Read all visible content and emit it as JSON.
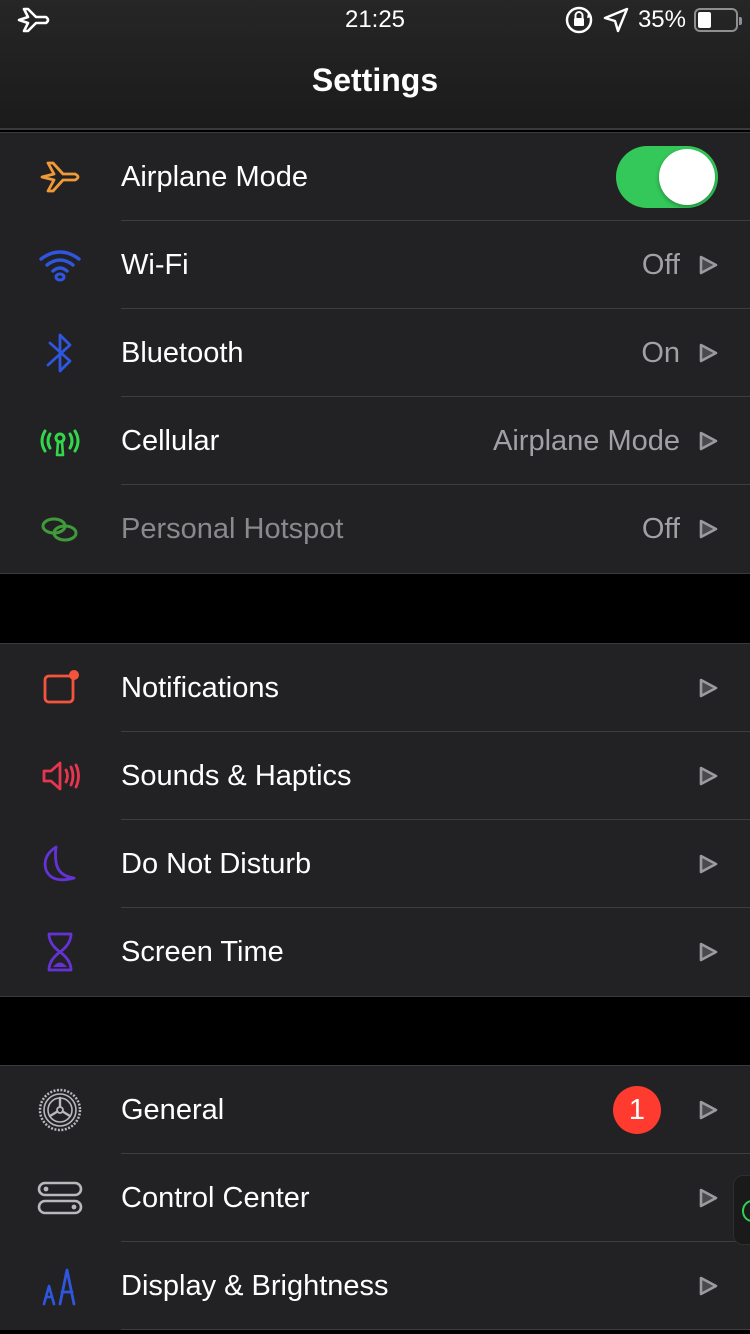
{
  "status_bar": {
    "time": "21:25",
    "battery_percent_label": "35%",
    "battery_level": 0.35,
    "icons": [
      "airplane-icon",
      "orientation-lock-icon",
      "location-arrow-icon",
      "battery-icon"
    ]
  },
  "header": {
    "title": "Settings"
  },
  "groups": [
    {
      "items": [
        {
          "label": "Airplane Mode",
          "icon": "airplane-icon",
          "icon_color": "#f09a37",
          "control": "toggle",
          "toggle_on": true
        },
        {
          "label": "Wi-Fi",
          "icon": "wifi-icon",
          "icon_color": "#2f56e0",
          "value": "Off"
        },
        {
          "label": "Bluetooth",
          "icon": "bluetooth-icon",
          "icon_color": "#2f56e0",
          "value": "On"
        },
        {
          "label": "Cellular",
          "icon": "cellular-antenna-icon",
          "icon_color": "#32d74b",
          "value": "Airplane Mode"
        },
        {
          "label": "Personal Hotspot",
          "icon": "hotspot-link-icon",
          "icon_color": "#3f9b3a",
          "value": "Off",
          "disabled": true
        }
      ]
    },
    {
      "items": [
        {
          "label": "Notifications",
          "icon": "notifications-icon",
          "icon_color": "#f2553c"
        },
        {
          "label": "Sounds & Haptics",
          "icon": "speaker-icon",
          "icon_color": "#e8364f"
        },
        {
          "label": "Do Not Disturb",
          "icon": "moon-icon",
          "icon_color": "#6532d6"
        },
        {
          "label": "Screen Time",
          "icon": "hourglass-icon",
          "icon_color": "#6532d6"
        }
      ]
    },
    {
      "items": [
        {
          "label": "General",
          "icon": "gear-icon",
          "icon_color": "#b8b8bd",
          "badge": "1"
        },
        {
          "label": "Control Center",
          "icon": "control-center-icon",
          "icon_color": "#b8b8bd"
        },
        {
          "label": "Display & Brightness",
          "icon": "text-size-icon",
          "icon_color": "#2f56e0"
        }
      ]
    }
  ],
  "colors": {
    "accent_green": "#34c759",
    "badge_red": "#ff3b30",
    "row_background": "#222224",
    "group_separator": "#000000"
  }
}
